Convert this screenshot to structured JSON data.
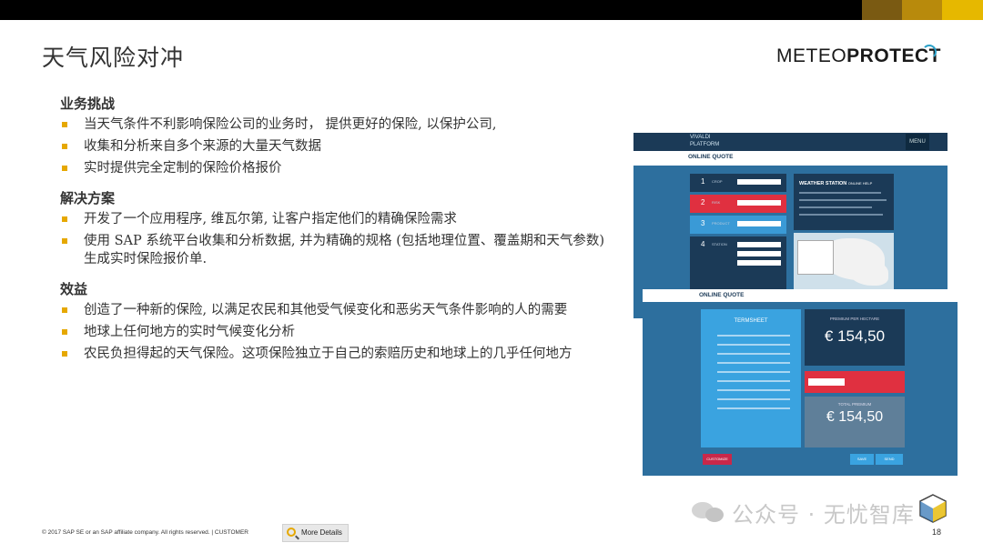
{
  "slide": {
    "title": "天气风险对冲",
    "logo": {
      "part1": "METEO",
      "part2": "PROTECT"
    },
    "sections": [
      {
        "title": "业务挑战",
        "bullets": [
          "当天气条件不利影响保险公司的业务时， 提供更好的保险, 以保护公司,",
          "收集和分析来自多个来源的大量天气数据",
          "实时提供完全定制的保险价格报价"
        ]
      },
      {
        "title": "解决方案",
        "bullets": [
          "开发了一个应用程序, 维瓦尔第, 让客户指定他们的精确保险需求",
          "使用 SAP 系统平台收集和分析数据, 并为精确的规格 (包括地理位置、覆盖期和天气参数) 生成实时保险报价单."
        ]
      },
      {
        "title": "效益",
        "bullets": [
          "创造了一种新的保险, 以满足农民和其他受气候变化和恶劣天气条件影响的人的需要",
          "地球上任何地方的实时气候变化分析",
          "农民负担得起的天气保险。这项保险独立于自己的索赔历史和地球上的几乎任何地方"
        ]
      }
    ],
    "footer": {
      "copyright": "© 2017 SAP SE or an SAP affiliate company. All rights reserved.  |  CUSTOMER",
      "more_details": "More Details",
      "page_number": "18"
    },
    "watermark": "公众号 · 无忧智库"
  },
  "mockup": {
    "top": {
      "brand": "VIVALDI",
      "brand_sub": "PLATFORM",
      "menu": "MENU",
      "header": "ONLINE QUOTE",
      "steps": [
        {
          "num": "1",
          "label": "CROP"
        },
        {
          "num": "2",
          "label": "RISK"
        },
        {
          "num": "3",
          "label": "PRODUCT"
        },
        {
          "num": "4",
          "label": "STATION"
        }
      ],
      "weather_station": "WEATHER STATION",
      "weather_station_sub": "ONLINE HELP"
    },
    "bottom": {
      "header": "ONLINE QUOTE",
      "termsheet": "TERMSHEET",
      "premium_label": "PREMIUM PER HECTARE",
      "premium_value": "€ 154,50",
      "total_label": "TOTAL PREMIUM",
      "total_value": "€ 154,50",
      "customize": "CUSTOMIZE",
      "btn_a": "SAVE",
      "btn_b": "SEND"
    }
  },
  "colors": {
    "accent": "#e6a800",
    "mock_blue": "#2d6f9e",
    "mock_navy": "#1b3a57",
    "mock_red": "#e03040"
  }
}
